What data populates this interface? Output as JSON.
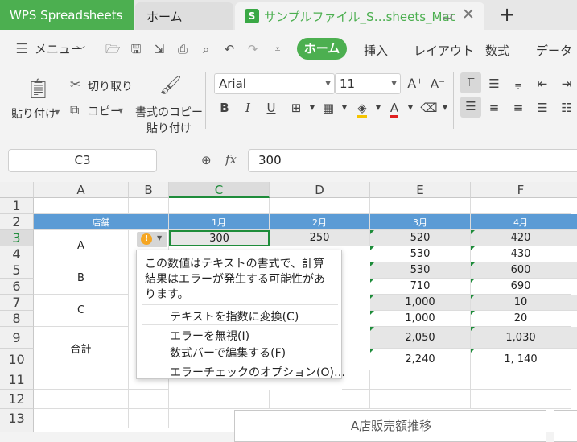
{
  "tabs": {
    "app": "WPS Spreadsheets",
    "home": "ホーム",
    "file": "サンプルファイル_S…sheets_Mac",
    "file_icon": "S"
  },
  "menubar": {
    "menu": "メニュー",
    "items": [
      "ホーム",
      "挿入",
      "レイアウト",
      "数式",
      "データ"
    ]
  },
  "ribbon": {
    "paste": "貼り付け",
    "cut": "切り取り",
    "copy": "コピー",
    "format_copy_1": "書式のコピー",
    "format_copy_2": "貼り付け",
    "font": "Arial",
    "font_size": "11",
    "bold": "B",
    "italic": "I",
    "underline": "U"
  },
  "formula_bar": {
    "name_box": "C3",
    "fx": "fx",
    "value": "300"
  },
  "columns": [
    "A",
    "B",
    "C",
    "D",
    "E",
    "F"
  ],
  "rows": [
    "1",
    "2",
    "3",
    "4",
    "5",
    "6",
    "7",
    "8",
    "9",
    "10",
    "11",
    "12",
    "13",
    "14"
  ],
  "table": {
    "header": [
      "店舗",
      "",
      "1月",
      "2月",
      "3月",
      "4月"
    ],
    "labels": {
      "a": "A",
      "b": "B",
      "c": "C",
      "total": "合計"
    },
    "c3": "300",
    "d3": "250",
    "e": [
      "520",
      "530",
      "530",
      "710",
      "1,000",
      "1,000",
      "2,050",
      "2,240"
    ],
    "f": [
      "420",
      "430",
      "600",
      "690",
      "10",
      "20",
      "1,030",
      "1, 140"
    ]
  },
  "popup": {
    "message": "この数値はテキストの書式で、計算結果はエラーが発生する可能性があります。",
    "items": [
      "テキストを指数に変換(C)",
      "エラーを無視(I)",
      "数式バーで編集する(F)",
      "エラーチェックのオプション(O)…"
    ]
  },
  "chart": {
    "title": "A店販売額推移"
  },
  "colors": {
    "brand": "#4caf50",
    "header_row": "#5b9bd5",
    "error_triangle": "#1e8c3a",
    "warning": "#f5a623"
  }
}
